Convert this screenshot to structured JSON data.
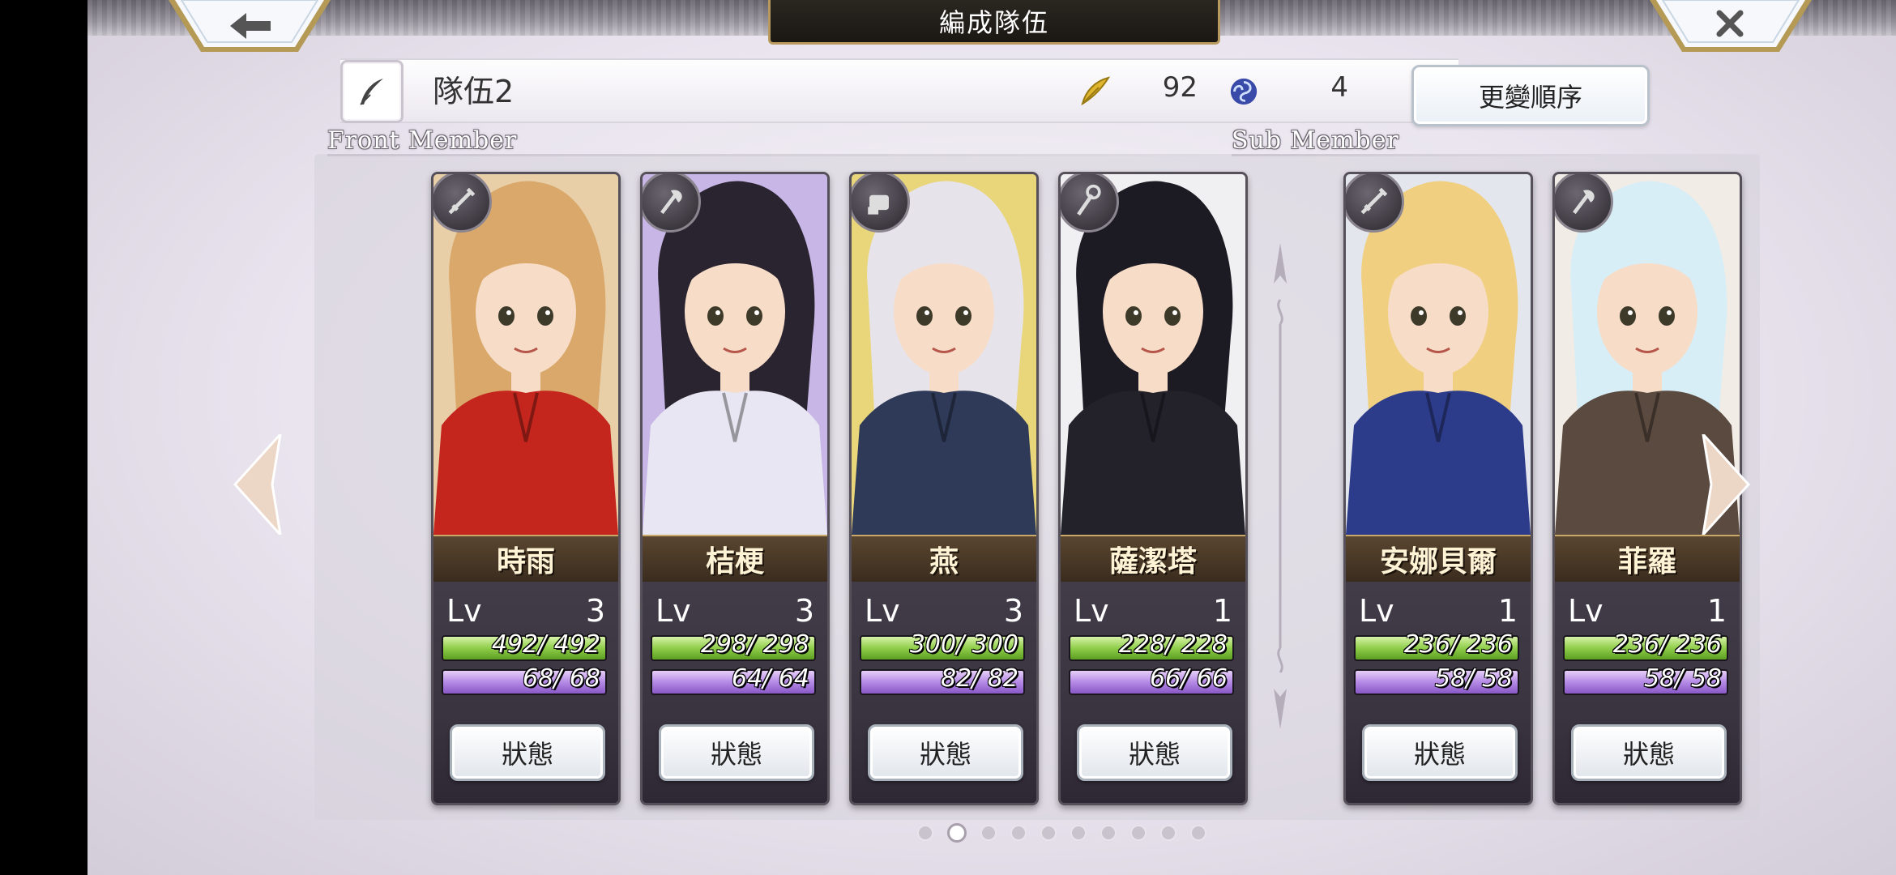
{
  "header": {
    "title": "編成隊伍"
  },
  "team": {
    "name": "隊伍2",
    "cost_value": "92",
    "orb_value": "4",
    "order_button": "更變順序"
  },
  "sections": {
    "front_label": "Front Member",
    "sub_label": "Sub Member"
  },
  "status_label": "狀態",
  "lv_label": "Lv",
  "front_members": [
    {
      "name": "時雨",
      "level": "3",
      "hp": "492/ 492",
      "sp": "68/ 68",
      "hair": "#d9a86a",
      "outfit": "#c4261e",
      "bg": "#e8cfa8",
      "weapon": "sword-icon"
    },
    {
      "name": "桔梗",
      "level": "3",
      "hp": "298/ 298",
      "sp": "64/ 64",
      "hair": "#2a2430",
      "outfit": "#e8e6f2",
      "bg": "#c7b6e6",
      "weapon": "axe-icon"
    },
    {
      "name": "燕",
      "level": "3",
      "hp": "300/ 300",
      "sp": "82/ 82",
      "hair": "#e6e4ea",
      "outfit": "#2e3a58",
      "bg": "#e9d67a",
      "weapon": "fist-icon"
    },
    {
      "name": "薩潔塔",
      "level": "1",
      "hp": "228/ 228",
      "sp": "66/ 66",
      "hair": "#1c1a22",
      "outfit": "#23222b",
      "bg": "#f0f0f2",
      "weapon": "staff-icon"
    }
  ],
  "sub_members": [
    {
      "name": "安娜貝爾",
      "level": "1",
      "hp": "236/ 236",
      "sp": "58/ 58",
      "hair": "#f0d080",
      "outfit": "#2d3c8a",
      "bg": "#e4e6ee",
      "weapon": "sword-icon"
    },
    {
      "name": "菲羅",
      "level": "1",
      "hp": "236/ 236",
      "sp": "58/ 58",
      "hair": "#d8eef6",
      "outfit": "#5a4a40",
      "bg": "#f2ece6",
      "weapon": "axe-icon"
    }
  ],
  "pagination": {
    "total": 10,
    "active_index": 1
  }
}
